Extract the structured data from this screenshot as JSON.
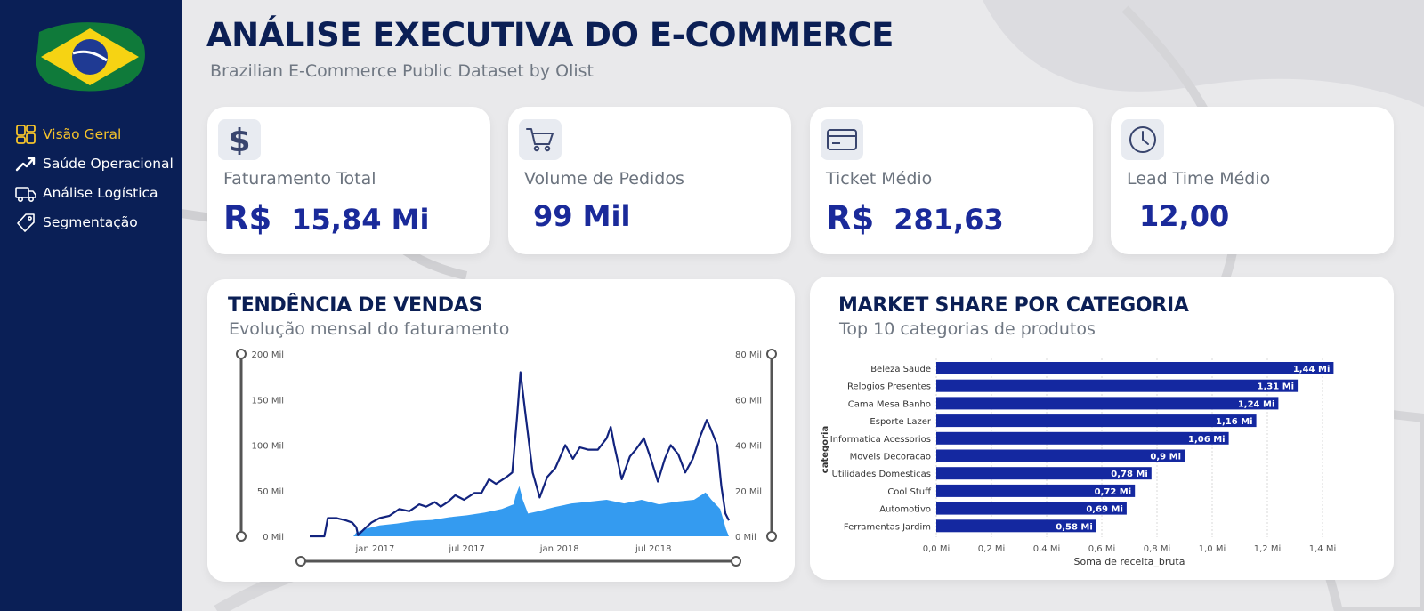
{
  "page": {
    "title": "ANÁLISE EXECUTIVA DO E-COMMERCE",
    "subtitle": "Brazilian E-Commerce Public Dataset by Olist"
  },
  "sidebar": {
    "items": [
      {
        "label": "Visão Geral",
        "icon": "dashboard-icon",
        "active": true
      },
      {
        "label": "Saúde Operacional",
        "icon": "trend-icon",
        "active": false
      },
      {
        "label": "Análise Logística",
        "icon": "truck-icon",
        "active": false
      },
      {
        "label": "Segmentação",
        "icon": "tag-icon",
        "active": false
      }
    ]
  },
  "kpis": [
    {
      "label": "Faturamento Total",
      "prefix": "R$",
      "value": "15,84 Mi",
      "icon": "dollar-icon"
    },
    {
      "label": "Volume de Pedidos",
      "prefix": "",
      "value": "99 Mil",
      "icon": "cart-icon"
    },
    {
      "label": "Ticket Médio",
      "prefix": "R$",
      "value": "281,63",
      "icon": "credit-card-icon"
    },
    {
      "label": "Lead Time Médio",
      "prefix": "",
      "value": "12,00",
      "icon": "clock-icon"
    }
  ],
  "colors": {
    "sidebar_bg": "#0a1f56",
    "accent_yellow": "#f4c22b",
    "title_navy": "#0b1f55",
    "kpi_blue": "#1a2a9a",
    "bar_blue": "#1428a0",
    "line_navy": "#12237e",
    "area_blue": "#1e90ee"
  },
  "trend_panel": {
    "title": "TENDÊNCIA DE VENDAS",
    "subtitle": "Evolução mensal do faturamento"
  },
  "share_panel": {
    "title": "MARKET SHARE POR CATEGORIA",
    "subtitle": "Top 10 categorias de produtos"
  },
  "chart_data": [
    {
      "type": "line",
      "title": "TENDÊNCIA DE VENDAS",
      "subtitle": "Evolução mensal do faturamento",
      "x_ticks": [
        "jan 2017",
        "jul 2017",
        "jan 2018",
        "jul 2018"
      ],
      "left_axis": {
        "ticks": [
          "0 Mil",
          "50 Mil",
          "100 Mil",
          "150 Mil",
          "200 Mil"
        ],
        "ylim": [
          0,
          200
        ]
      },
      "right_axis": {
        "ticks": [
          "0 Mil",
          "20 Mil",
          "40 Mil",
          "60 Mil",
          "80 Mil"
        ],
        "ylim": [
          0,
          80
        ]
      },
      "series": [
        {
          "axis": "right",
          "style": "line",
          "points": [
            [
              0.0,
              0
            ],
            [
              2.5,
              0
            ],
            [
              3.1,
              8
            ],
            [
              4.6,
              8
            ],
            [
              6.2,
              7
            ],
            [
              7.3,
              6
            ],
            [
              8.0,
              4
            ],
            [
              8.3,
              0.5
            ],
            [
              9.3,
              3
            ],
            [
              10.6,
              6
            ],
            [
              12.0,
              8
            ],
            [
              13.7,
              9
            ],
            [
              15.4,
              12
            ],
            [
              17.1,
              11
            ],
            [
              18.8,
              14
            ],
            [
              20.0,
              13
            ],
            [
              21.5,
              15
            ],
            [
              22.5,
              13
            ],
            [
              23.7,
              15
            ],
            [
              25.0,
              18
            ],
            [
              26.5,
              16
            ],
            [
              28.3,
              19
            ],
            [
              29.5,
              19
            ],
            [
              30.8,
              25
            ],
            [
              32.0,
              23
            ],
            [
              33.8,
              26
            ],
            [
              34.8,
              28
            ],
            [
              35.6,
              52
            ],
            [
              36.2,
              72
            ],
            [
              37.0,
              55
            ],
            [
              38.3,
              28
            ],
            [
              39.5,
              17
            ],
            [
              40.8,
              26
            ],
            [
              42.2,
              30
            ],
            [
              43.9,
              40
            ],
            [
              45.2,
              34
            ],
            [
              46.4,
              39
            ],
            [
              47.8,
              38
            ],
            [
              49.5,
              38
            ],
            [
              51.0,
              43
            ],
            [
              51.7,
              48
            ],
            [
              52.3,
              40
            ],
            [
              53.6,
              25
            ],
            [
              55.0,
              35
            ],
            [
              56.0,
              38
            ],
            [
              57.4,
              43
            ],
            [
              58.6,
              34
            ],
            [
              59.8,
              24
            ],
            [
              61.0,
              34
            ],
            [
              62.0,
              40
            ],
            [
              63.3,
              36
            ],
            [
              64.5,
              28
            ],
            [
              65.8,
              34
            ],
            [
              67.1,
              44
            ],
            [
              68.2,
              51
            ],
            [
              68.9,
              47
            ],
            [
              70.0,
              40
            ],
            [
              70.7,
              22
            ],
            [
              71.4,
              10
            ],
            [
              72.0,
              7
            ]
          ]
        },
        {
          "axis": "left",
          "style": "area",
          "points": [
            [
              7.5,
              0
            ],
            [
              8.0,
              4
            ],
            [
              9.5,
              8
            ],
            [
              12.0,
              12
            ],
            [
              15.0,
              14
            ],
            [
              18.0,
              17
            ],
            [
              21.0,
              18
            ],
            [
              24.0,
              21
            ],
            [
              27.0,
              23
            ],
            [
              30.0,
              26
            ],
            [
              33.0,
              30
            ],
            [
              35.0,
              35
            ],
            [
              35.4,
              45
            ],
            [
              36.0,
              55
            ],
            [
              36.6,
              40
            ],
            [
              37.5,
              25
            ],
            [
              39.0,
              27
            ],
            [
              42.0,
              32
            ],
            [
              45.0,
              36
            ],
            [
              48.0,
              38
            ],
            [
              51.0,
              40
            ],
            [
              54.0,
              36
            ],
            [
              57.0,
              40
            ],
            [
              60.0,
              35
            ],
            [
              63.0,
              38
            ],
            [
              66.0,
              40
            ],
            [
              68.0,
              48
            ],
            [
              69.0,
              40
            ],
            [
              70.5,
              30
            ],
            [
              71.5,
              8
            ],
            [
              72.0,
              0
            ]
          ]
        }
      ]
    },
    {
      "type": "bar",
      "orientation": "horizontal",
      "title": "MARKET SHARE POR CATEGORIA",
      "subtitle": "Top 10 categorias de produtos",
      "ylabel": "categoria",
      "xlabel": "Soma de receita_bruta",
      "x_ticks": [
        "0,0 Mi",
        "0,2 Mi",
        "0,4 Mi",
        "0,6 Mi",
        "0,8 Mi",
        "1,0 Mi",
        "1,2 Mi",
        "1,4 Mi"
      ],
      "xlim": [
        0,
        1.4
      ],
      "categories": [
        "Beleza Saude",
        "Relogios Presentes",
        "Cama Mesa Banho",
        "Esporte Lazer",
        "Informatica Acessorios",
        "Moveis Decoracao",
        "Utilidades Domesticas",
        "Cool Stuff",
        "Automotivo",
        "Ferramentas Jardim"
      ],
      "values": [
        1.44,
        1.31,
        1.24,
        1.16,
        1.06,
        0.9,
        0.78,
        0.72,
        0.69,
        0.58
      ],
      "labels": [
        "1,44 Mi",
        "1,31 Mi",
        "1,24 Mi",
        "1,16 Mi",
        "1,06 Mi",
        "0,9 Mi",
        "0,78 Mi",
        "0,72 Mi",
        "0,69 Mi",
        "0,58 Mi"
      ]
    }
  ]
}
